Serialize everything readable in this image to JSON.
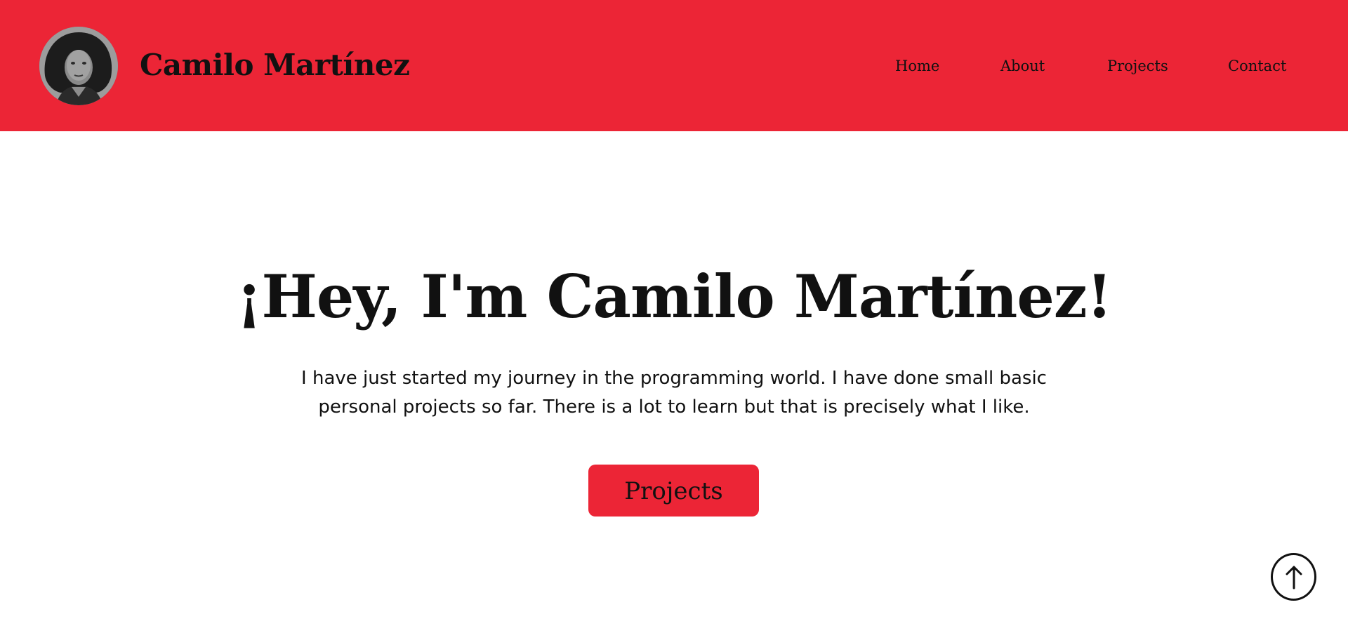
{
  "header": {
    "site_name": "Camilo Martínez",
    "background_color": "#ec2536"
  },
  "nav": {
    "items": [
      {
        "label": "Home"
      },
      {
        "label": "About"
      },
      {
        "label": "Projects"
      },
      {
        "label": "Contact"
      }
    ]
  },
  "hero": {
    "title": "¡Hey, I'm Camilo Martínez!",
    "text_line_1": "I have just started my journey in the programming world. I have done small basic",
    "text_line_2": "personal projects so far. There is a lot to learn but that is precisely what I like.",
    "button_label": "Projects",
    "button_color": "#ec2536"
  },
  "icons": {
    "scroll_top": "arrow-up-icon"
  }
}
